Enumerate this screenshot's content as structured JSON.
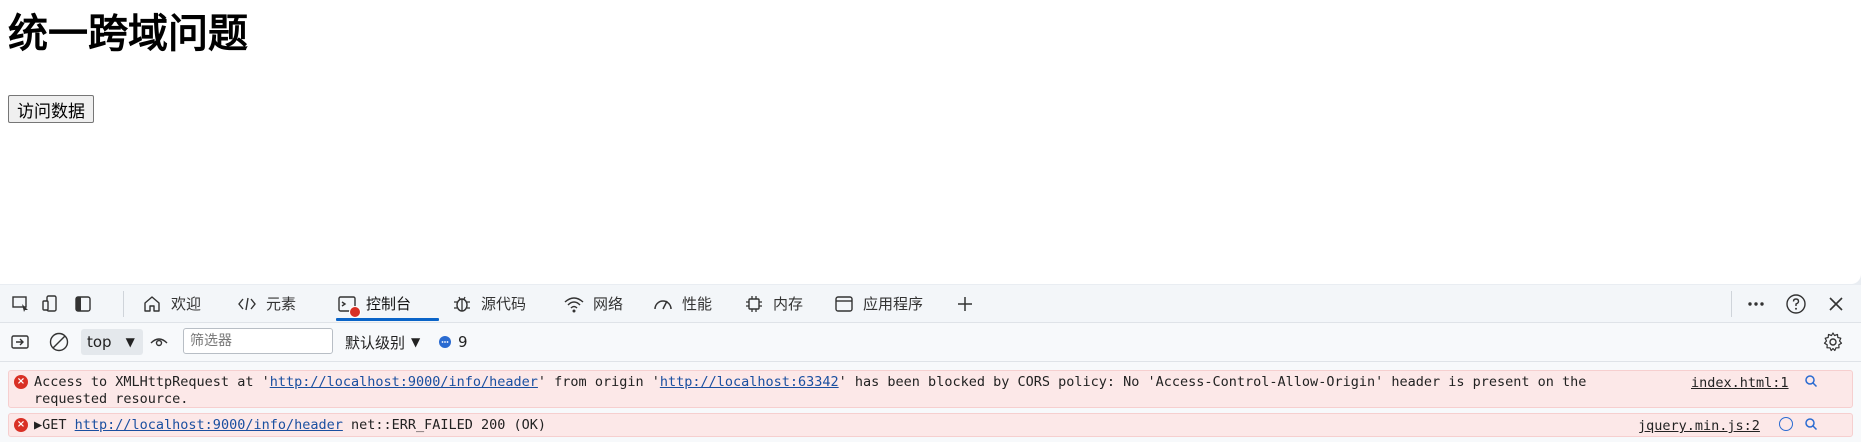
{
  "page": {
    "heading": "统一跨域问题",
    "button_label": "访问数据"
  },
  "devtools": {
    "tabs": [
      {
        "label": "欢迎",
        "icon": "home-icon"
      },
      {
        "label": "元素",
        "icon": "code-icon"
      },
      {
        "label": "控制台",
        "icon": "console-icon",
        "active": true
      },
      {
        "label": "源代码",
        "icon": "bug-icon"
      },
      {
        "label": "网络",
        "icon": "wifi-icon"
      },
      {
        "label": "性能",
        "icon": "gauge-icon"
      },
      {
        "label": "内存",
        "icon": "chip-icon"
      },
      {
        "label": "应用程序",
        "icon": "window-icon"
      }
    ],
    "toolbar": {
      "context": "top",
      "filter_placeholder": "筛选器",
      "levels": "默认级别",
      "message_count": "9"
    },
    "console": {
      "messages": [
        {
          "type": "error",
          "prefix": "Access to XMLHttpRequest at '",
          "link1": "http://localhost:9000/info/header",
          "middle": "' from origin '",
          "link2": "http://localhost:63342",
          "suffix": "' has been blocked by CORS policy: No 'Access-Control-Allow-Origin' header is present on the requested resource.",
          "source": "index.html:1"
        },
        {
          "type": "error",
          "prefix": "▶GET ",
          "link1": "http://localhost:9000/info/header",
          "suffix": " net::ERR_FAILED 200 (OK)",
          "source": "jquery.min.js:2"
        }
      ]
    }
  },
  "colors": {
    "error_bg": "#fce8e8",
    "error_icon": "#d93025",
    "link": "#1a4fa0",
    "active_tab_underline": "#0a64c8"
  }
}
